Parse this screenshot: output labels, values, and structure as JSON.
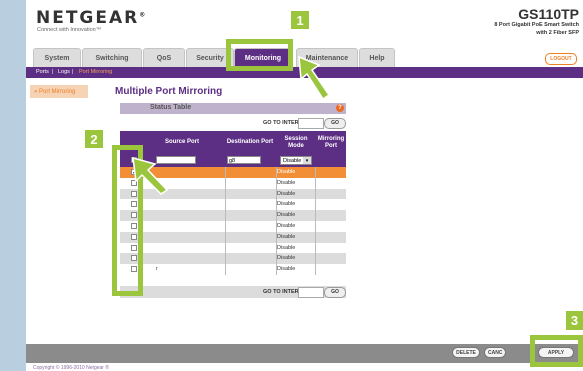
{
  "header": {
    "logo": "NETGEAR",
    "logo_mark": "®",
    "tagline": "Connect with Innovation™",
    "model": "GS110TP",
    "model_desc_line1": "8 Port Gigabit PoE Smart Switch",
    "model_desc_line2": "with 2 Fiber SFP"
  },
  "tabs": [
    {
      "label": "System"
    },
    {
      "label": "Switching"
    },
    {
      "label": "QoS"
    },
    {
      "label": "Security"
    },
    {
      "label": "Monitoring"
    },
    {
      "label": "Maintenance"
    },
    {
      "label": "Help"
    }
  ],
  "logout_label": "LOGOUT",
  "subnav": {
    "ports": "Ports",
    "sep1": "|",
    "logs": "Logs",
    "sep2": "|",
    "port_mirroring": "Port Mirroring"
  },
  "sidebar": {
    "item": "» Port Mirroring"
  },
  "page_title": "Multiple Port Mirroring",
  "status_table": {
    "title": "Status Table",
    "help_icon": "?",
    "goto_label": "GO TO INTERFACE",
    "go_button": "GO",
    "columns": {
      "source_port": "Source Port",
      "destination_port": "Destination Port",
      "session_mode_1": "Session",
      "session_mode_2": "Mode",
      "mirroring_port_1": "Mirroring",
      "mirroring_port_2": "Port"
    },
    "input_row": {
      "destination_value": "g8",
      "session_value": "Disable"
    },
    "rows": [
      {
        "checked": true,
        "session": "Disable"
      },
      {
        "checked": false,
        "session": "Disable"
      },
      {
        "checked": false,
        "session": "Disable"
      },
      {
        "checked": false,
        "session": "Disable"
      },
      {
        "checked": false,
        "session": "Disable"
      },
      {
        "checked": false,
        "session": "Disable"
      },
      {
        "checked": false,
        "session": "Disable"
      },
      {
        "checked": false,
        "session": "Disable"
      },
      {
        "checked": false,
        "session": "Disable"
      },
      {
        "checked": false,
        "session": "Disable",
        "port": "r"
      }
    ],
    "checkmark": "✓"
  },
  "footer": {
    "delete_label": "DELETE",
    "cancel_label": "CANC",
    "apply_label": "APPLY",
    "copyright": "Copyright © 1996-2010 Netgear ®"
  },
  "callouts": {
    "step1": "1",
    "step2": "2",
    "step3": "3"
  },
  "colors": {
    "accent_purple": "#5d2f84",
    "accent_orange": "#f07f22",
    "highlight_green": "#9bc53d"
  }
}
